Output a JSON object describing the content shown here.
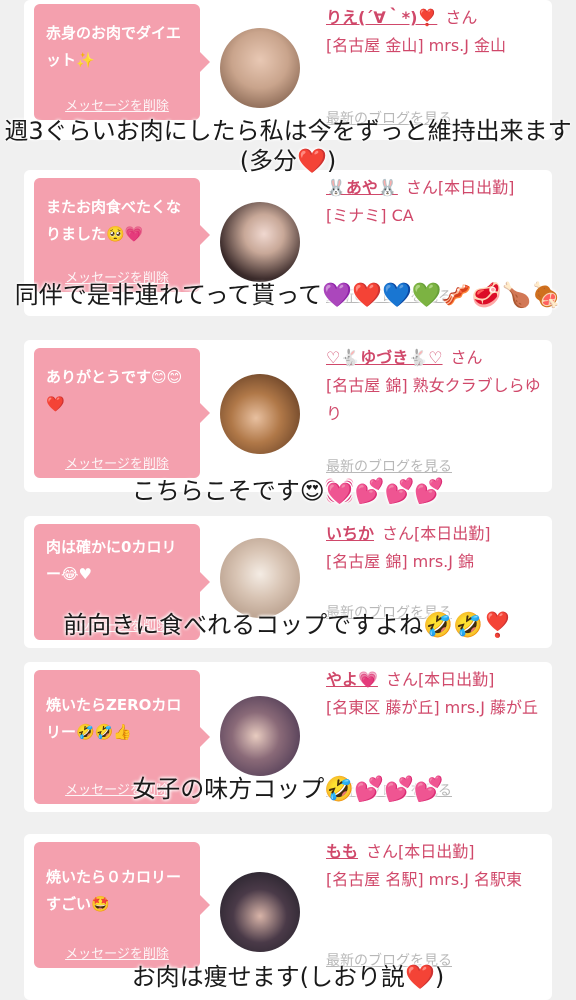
{
  "cards": [
    {
      "message": "赤身のお肉でダイエット✨",
      "delete_label": "メッセージを削除",
      "name": "りえ(´∀｀*)❣️",
      "san": "さん",
      "shop": "[名古屋 金山] mrs.J 金山",
      "blog_label": "最新のブログを見る",
      "avatar_color": "#c9a48c"
    },
    {
      "message": "またお肉食べたくなりました🥺💗",
      "delete_label": "メッセージを削除",
      "name": "🐰あや🐰",
      "san": "さん[本日出勤]",
      "shop": "[ミナミ] CA",
      "blog_label": "最新のブログを見る",
      "avatar_color": "#3a2a2a"
    },
    {
      "message": "ありがとうです😊😊❤️",
      "delete_label": "メッセージを削除",
      "name": "♡🐇ゆづき🐇♡",
      "san": "さん",
      "shop": "[名古屋 錦] 熟女クラブしらゆり",
      "blog_label": "最新のブログを見る",
      "avatar_color": "#7a4a2a"
    },
    {
      "message": "肉は確かに0カロリー😂♥",
      "delete_label": "メッセージを削除",
      "name": "いちか",
      "san": "さん[本日出勤]",
      "shop": "[名古屋 錦] mrs.J 錦",
      "blog_label": "最新のブログを見る",
      "avatar_color": "#c8b4a4"
    },
    {
      "message": "焼いたらZEROカロリー🤣🤣👍",
      "delete_label": "メッセージを削除",
      "name": "やよ💗",
      "san": "さん[本日出勤]",
      "shop": "[名東区 藤が丘] mrs.J 藤が丘",
      "blog_label": "最新のブログを見る",
      "avatar_color": "#6a5a78"
    },
    {
      "message": "焼いたら０カロリーすごい🤩",
      "delete_label": "メッセージを削除",
      "name": "もも",
      "san": "さん[本日出勤]",
      "shop": "[名古屋 名駅] mrs.J 名駅東",
      "blog_label": "最新のブログを見る",
      "avatar_color": "#2a2a2e"
    }
  ],
  "captions": [
    "週3ぐらいお肉にしたら私は今をずっと維持出来ます(多分❤️)",
    "同伴で是非連れてって貰って💜❤️💙💚🥓🥩🍗🍖",
    "こちらこそです😍💓💕💕💕",
    "前向きに食べれるコップですよね🤣🤣❣️",
    "女子の味方コップ🤣💕💕💕",
    "お肉は痩せます(しおり説❤️)"
  ],
  "colors": {
    "bubble": "#f4a0ae",
    "accent": "#d0486a",
    "background": "#f0f0f0"
  }
}
